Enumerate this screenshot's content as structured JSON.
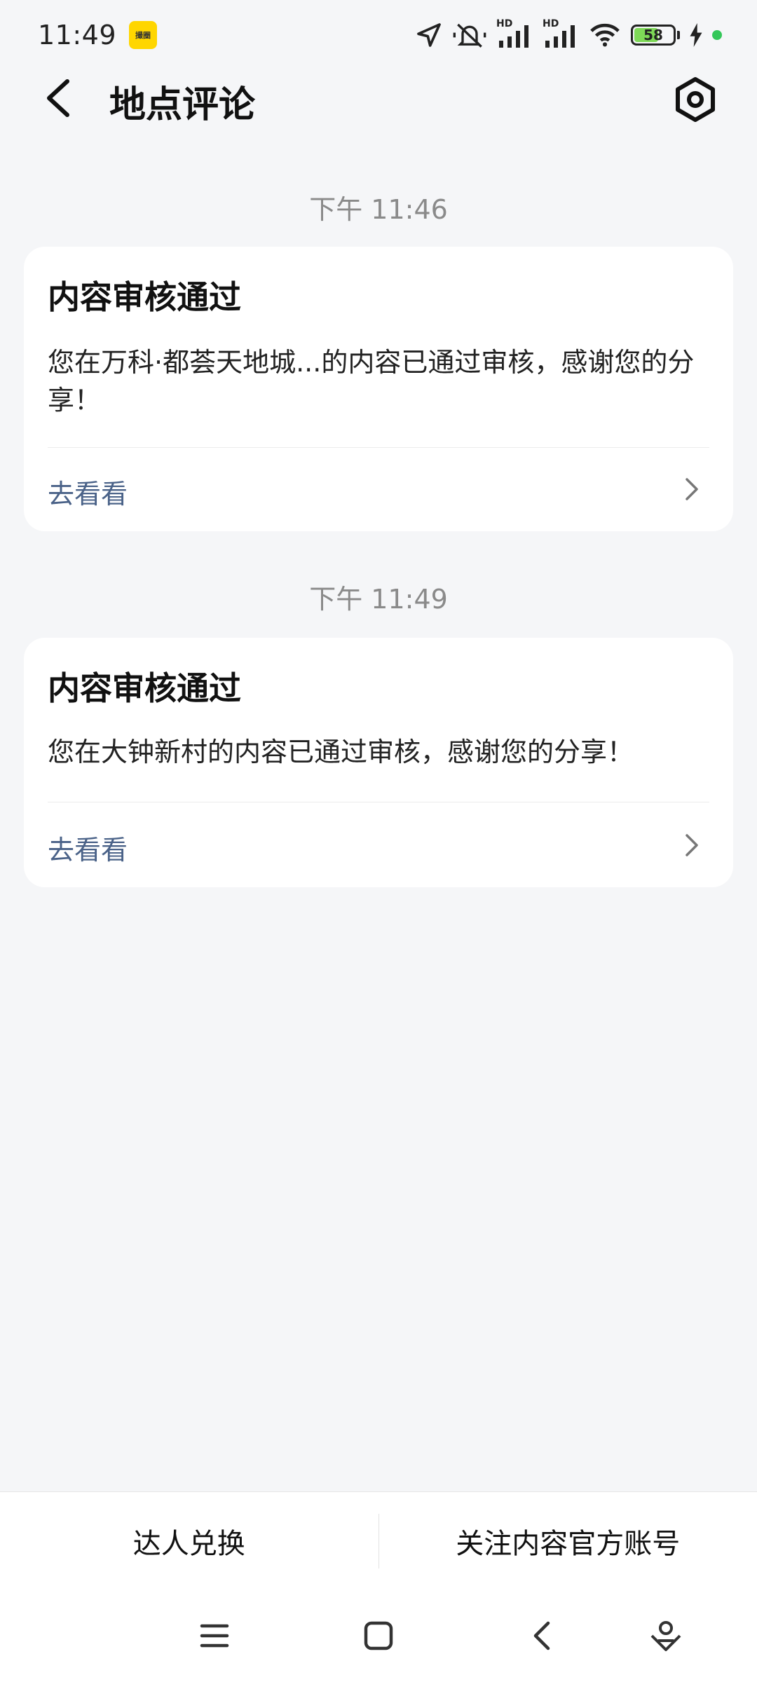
{
  "status_bar": {
    "time": "11:49",
    "app_badge_text": "撮圈",
    "battery": "58",
    "network_labels": [
      "HD",
      "HD"
    ]
  },
  "header": {
    "title": "地点评论"
  },
  "messages": [
    {
      "time": "下午 11:46",
      "title": "内容审核通过",
      "body": "您在万科·都荟天地城...的内容已通过审核，感谢您的分享！",
      "link": "去看看"
    },
    {
      "time": "下午 11:49",
      "title": "内容审核通过",
      "body": "您在大钟新村的内容已通过审核，感谢您的分享！",
      "link": "去看看"
    }
  ],
  "bottom_bar": {
    "left_label": "达人兑换",
    "right_label": "关注内容官方账号"
  },
  "colors": {
    "background": "#f5f6f8",
    "card": "#ffffff",
    "link": "#4a6288",
    "timestamp": "#8a8a8a",
    "battery_fill": "#7ed957",
    "charging_dot": "#34c759",
    "app_badge": "#ffd600"
  },
  "icons": [
    "location-arrow-icon",
    "mute-icon",
    "signal-icon",
    "wifi-icon",
    "battery-icon",
    "charging-icon",
    "back-icon",
    "settings-icon",
    "chevron-right-icon",
    "menu-icon",
    "home-icon",
    "nav-back-icon",
    "assistant-icon"
  ]
}
